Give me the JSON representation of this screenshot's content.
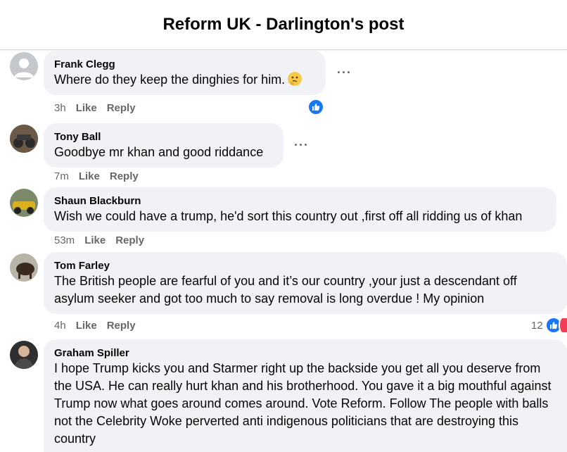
{
  "header": {
    "title": "Reform UK - Darlington's post"
  },
  "actions": {
    "like": "Like",
    "reply": "Reply"
  },
  "comments": [
    {
      "author": "Frank Clegg",
      "text": "Where do they keep the dinghies for him.",
      "emoji": "thinking-face",
      "time": "3h",
      "reaction": "like"
    },
    {
      "author": "Tony Ball",
      "text": "Goodbye mr khan and good riddance",
      "time": "7m"
    },
    {
      "author": "Shaun Blackburn",
      "text": "Wish we could have a trump, he'd sort this country out ,first off all ridding us of khan",
      "time": "53m"
    },
    {
      "author": "Tom Farley",
      "text": "The British people are fearful of you and it’s our country ,your just a descendant off asylum seeker and got too much to say removal is long overdue ! My opinion",
      "time": "4h",
      "reaction_count": "12",
      "reactions": [
        "like",
        "love"
      ]
    },
    {
      "author": "Graham Spiller",
      "text": "I hope Trump kicks you and Starmer right up the backside you get all you deserve from the USA. He can really hurt khan and his brotherhood. You gave it a big mouthful against Trump now what goes around comes around. Vote Reform. Follow The people with balls not the Celebrity Woke perverted anti indigenous politicians that are destroying this country"
    }
  ],
  "colors": {
    "like_blue": "#1877f2",
    "love_red": "#f33e58",
    "bubble": "#f0f2f5",
    "meta_gray": "#65676b"
  }
}
